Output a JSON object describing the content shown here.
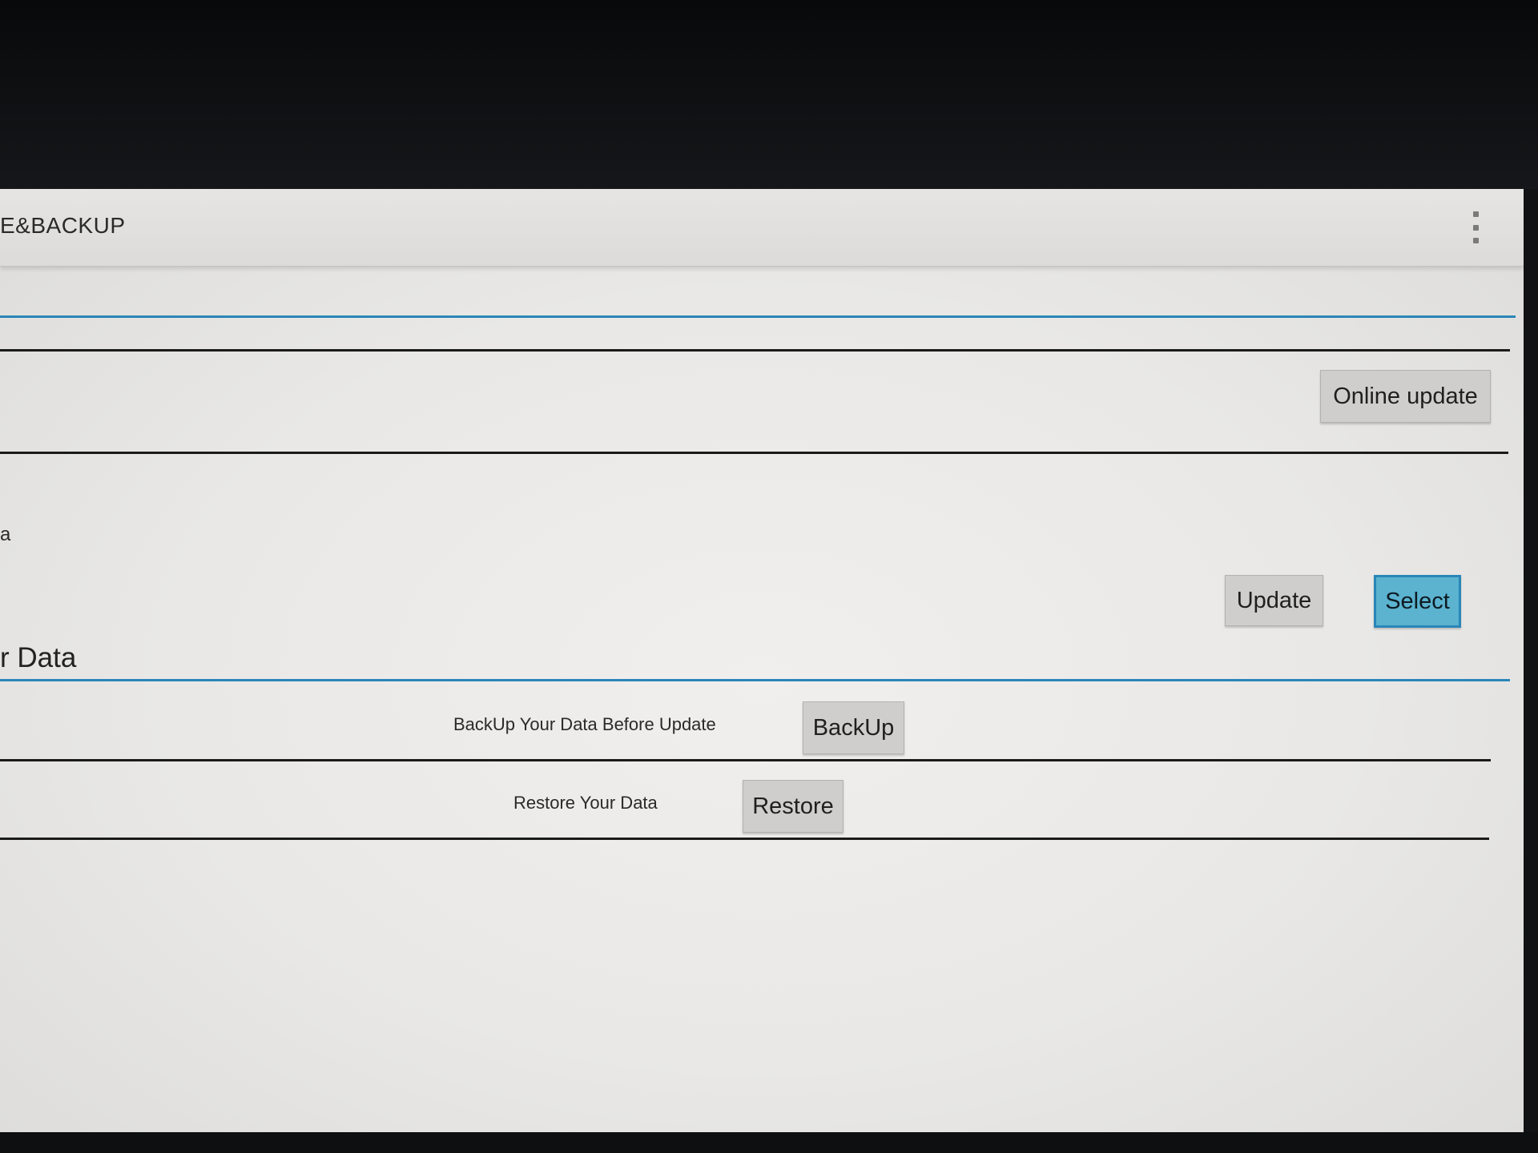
{
  "app_bar": {
    "title": "E&BACKUP",
    "menu_icon": "overflow-menu-icon"
  },
  "update_section": {
    "online_update_label": "Online update",
    "partial_label": "a",
    "update_label": "Update",
    "select_label": "Select"
  },
  "data_section": {
    "heading": "r Data",
    "backup_description": "BackUp Your Data Before Update",
    "backup_label": "BackUp",
    "restore_description": "Restore Your Data",
    "restore_label": "Restore"
  },
  "colors": {
    "accent": "#2a86b8",
    "selected_button": "#5bb3cf",
    "button": "#cfcecc",
    "background": "#ecebe9"
  }
}
